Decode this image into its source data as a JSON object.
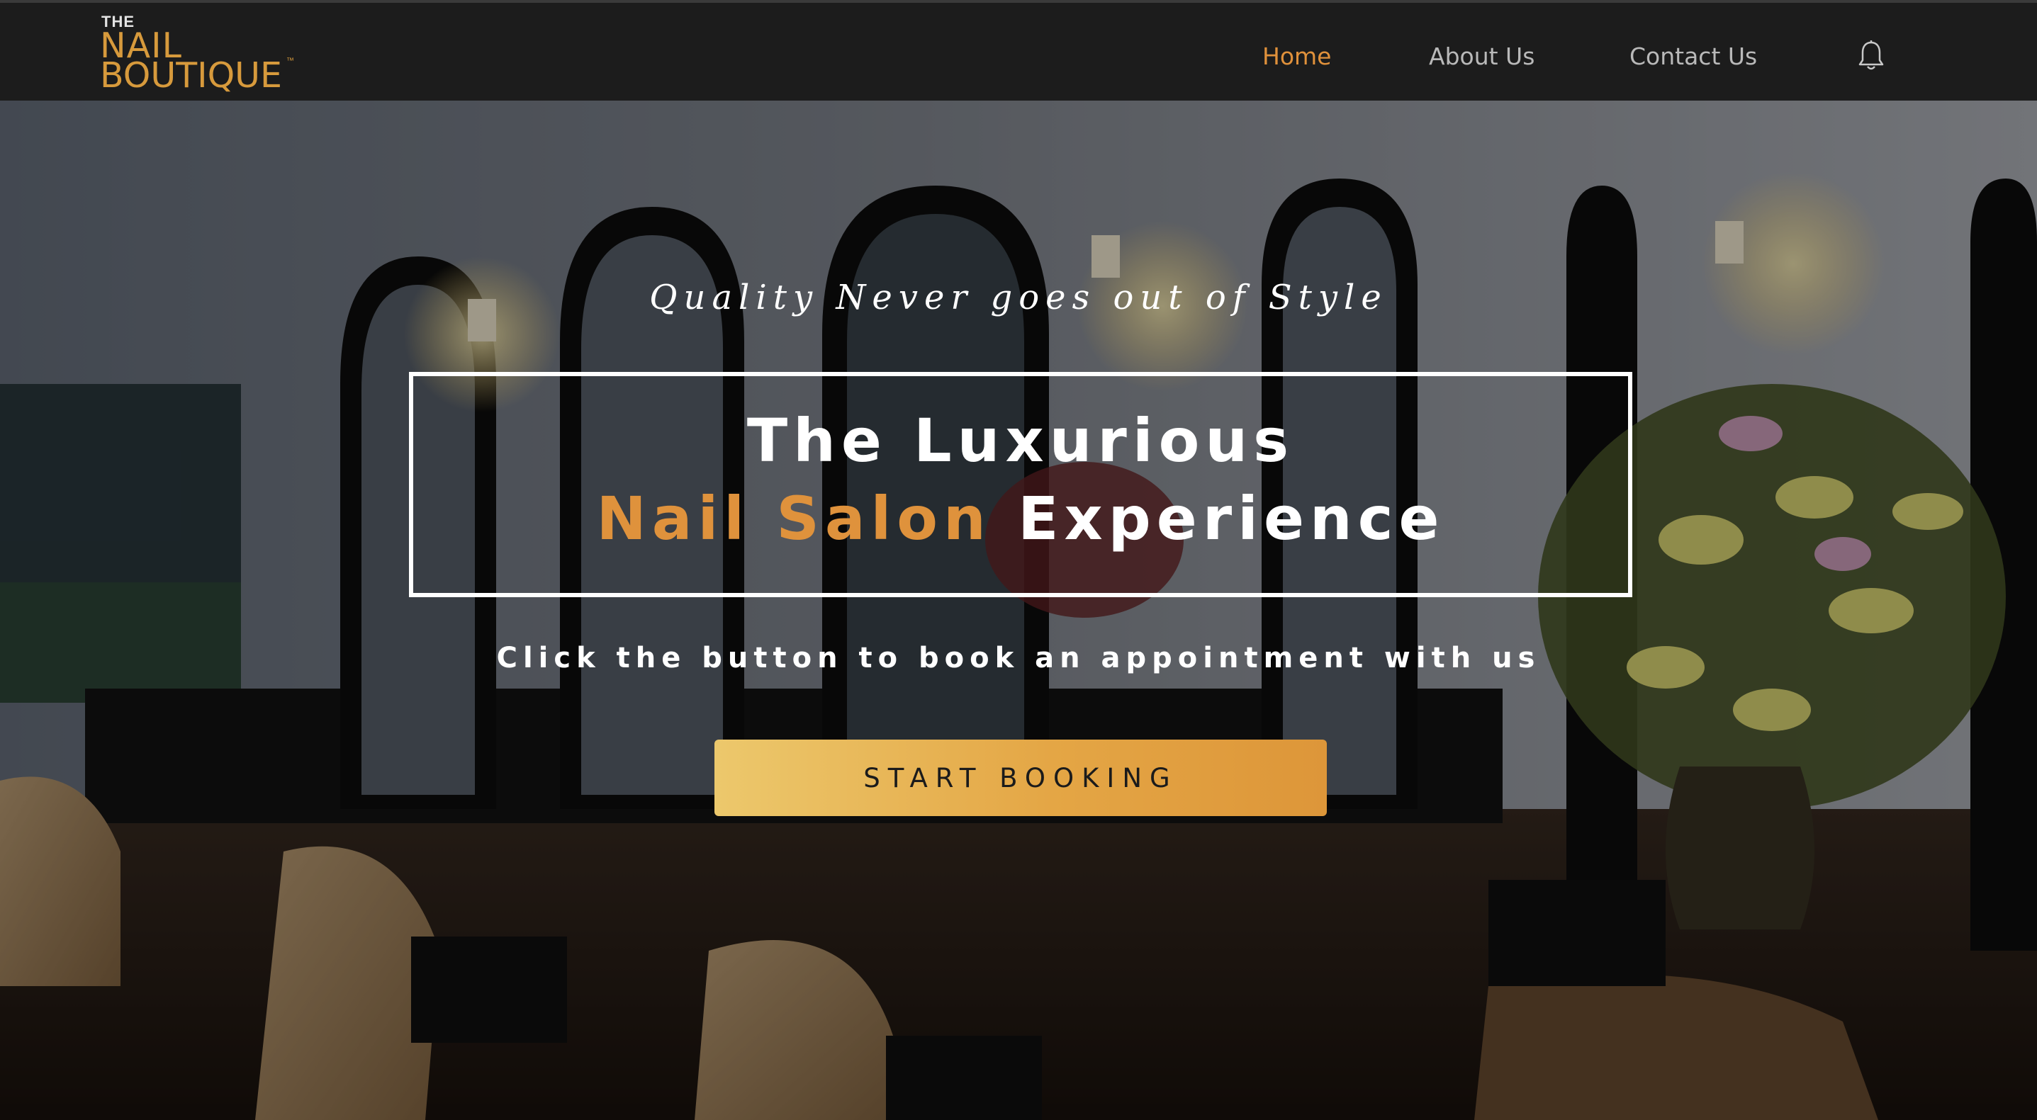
{
  "header": {
    "logo": {
      "the": "THE",
      "nail": "NAIL",
      "boutique": "BOUTIQUE",
      "tm": "™"
    },
    "nav": [
      {
        "label": "Home",
        "active": true
      },
      {
        "label": "About Us",
        "active": false
      },
      {
        "label": "Contact Us",
        "active": false
      }
    ],
    "notification_icon": "bell-icon"
  },
  "hero": {
    "tagline": "Quality Never goes out of Style",
    "headline_line1": "The Luxurious",
    "headline_line2_accent": "Nail Salon",
    "headline_line2_rest": "Experience",
    "subline": "Click the button to book an appointment with us",
    "cta_label": "START BOOKING"
  },
  "colors": {
    "accent": "#df923c",
    "nav_active": "#e0913b",
    "nav_text": "#b9b9b9",
    "header_bg": "#1c1c1c",
    "cta_gradient_start": "#ecc86c",
    "cta_gradient_end": "#dd9639"
  }
}
